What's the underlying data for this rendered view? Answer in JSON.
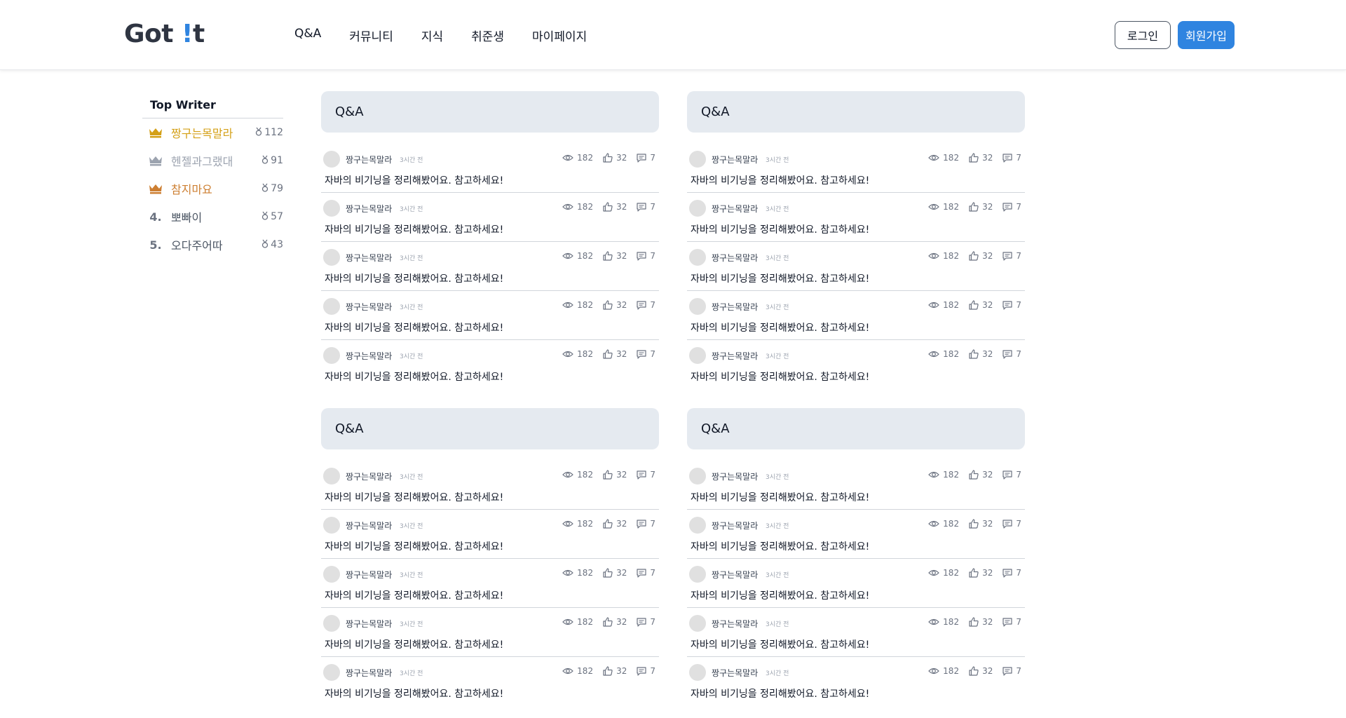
{
  "header": {
    "logo_main": "Got ",
    "logo_accent": "!",
    "logo_tail": "t",
    "nav": [
      "Q&A",
      "커뮤니티",
      "지식",
      "취준생",
      "마이페이지"
    ],
    "login_label": "로그인",
    "signup_label": "회원가입"
  },
  "sidebar": {
    "title": "Top Writer",
    "writers": [
      {
        "rank": "1",
        "icon": "crown-gold-icon",
        "name": "짱구는목말라",
        "score": "112",
        "color": "#d4a017"
      },
      {
        "rank": "2",
        "icon": "crown-silver-icon",
        "name": "헨젤과그랬대",
        "score": "91",
        "color": "#9ca3af"
      },
      {
        "rank": "3",
        "icon": "crown-bronze-icon",
        "name": "참지마요",
        "score": "79",
        "color": "#cd7f32"
      },
      {
        "rank": "4.",
        "icon": "",
        "name": "뽀빠이",
        "score": "57",
        "color": "#4b5563"
      },
      {
        "rank": "5.",
        "icon": "",
        "name": "오다주어따",
        "score": "43",
        "color": "#4b5563"
      }
    ]
  },
  "cards": [
    {
      "title": "Q&A",
      "posts": [
        {
          "author": "짱구는목말라",
          "time": "3시간 전",
          "views": "182",
          "likes": "32",
          "comments": "7",
          "title": "자바의 비기닝을 정리해봤어요. 참고하세요!"
        },
        {
          "author": "짱구는목말라",
          "time": "3시간 전",
          "views": "182",
          "likes": "32",
          "comments": "7",
          "title": "자바의 비기닝을 정리해봤어요. 참고하세요!"
        },
        {
          "author": "짱구는목말라",
          "time": "3시간 전",
          "views": "182",
          "likes": "32",
          "comments": "7",
          "title": "자바의 비기닝을 정리해봤어요. 참고하세요!"
        },
        {
          "author": "짱구는목말라",
          "time": "3시간 전",
          "views": "182",
          "likes": "32",
          "comments": "7",
          "title": "자바의 비기닝을 정리해봤어요. 참고하세요!"
        },
        {
          "author": "짱구는목말라",
          "time": "3시간 전",
          "views": "182",
          "likes": "32",
          "comments": "7",
          "title": "자바의 비기닝을 정리해봤어요. 참고하세요!"
        }
      ]
    },
    {
      "title": "Q&A",
      "posts": [
        {
          "author": "짱구는목말라",
          "time": "3시간 전",
          "views": "182",
          "likes": "32",
          "comments": "7",
          "title": "자바의 비기닝을 정리해봤어요. 참고하세요!"
        },
        {
          "author": "짱구는목말라",
          "time": "3시간 전",
          "views": "182",
          "likes": "32",
          "comments": "7",
          "title": "자바의 비기닝을 정리해봤어요. 참고하세요!"
        },
        {
          "author": "짱구는목말라",
          "time": "3시간 전",
          "views": "182",
          "likes": "32",
          "comments": "7",
          "title": "자바의 비기닝을 정리해봤어요. 참고하세요!"
        },
        {
          "author": "짱구는목말라",
          "time": "3시간 전",
          "views": "182",
          "likes": "32",
          "comments": "7",
          "title": "자바의 비기닝을 정리해봤어요. 참고하세요!"
        },
        {
          "author": "짱구는목말라",
          "time": "3시간 전",
          "views": "182",
          "likes": "32",
          "comments": "7",
          "title": "자바의 비기닝을 정리해봤어요. 참고하세요!"
        }
      ]
    },
    {
      "title": "Q&A",
      "posts": [
        {
          "author": "짱구는목말라",
          "time": "3시간 전",
          "views": "182",
          "likes": "32",
          "comments": "7",
          "title": "자바의 비기닝을 정리해봤어요. 참고하세요!"
        },
        {
          "author": "짱구는목말라",
          "time": "3시간 전",
          "views": "182",
          "likes": "32",
          "comments": "7",
          "title": "자바의 비기닝을 정리해봤어요. 참고하세요!"
        },
        {
          "author": "짱구는목말라",
          "time": "3시간 전",
          "views": "182",
          "likes": "32",
          "comments": "7",
          "title": "자바의 비기닝을 정리해봤어요. 참고하세요!"
        },
        {
          "author": "짱구는목말라",
          "time": "3시간 전",
          "views": "182",
          "likes": "32",
          "comments": "7",
          "title": "자바의 비기닝을 정리해봤어요. 참고하세요!"
        },
        {
          "author": "짱구는목말라",
          "time": "3시간 전",
          "views": "182",
          "likes": "32",
          "comments": "7",
          "title": "자바의 비기닝을 정리해봤어요. 참고하세요!"
        }
      ]
    },
    {
      "title": "Q&A",
      "posts": [
        {
          "author": "짱구는목말라",
          "time": "3시간 전",
          "views": "182",
          "likes": "32",
          "comments": "7",
          "title": "자바의 비기닝을 정리해봤어요. 참고하세요!"
        },
        {
          "author": "짱구는목말라",
          "time": "3시간 전",
          "views": "182",
          "likes": "32",
          "comments": "7",
          "title": "자바의 비기닝을 정리해봤어요. 참고하세요!"
        },
        {
          "author": "짱구는목말라",
          "time": "3시간 전",
          "views": "182",
          "likes": "32",
          "comments": "7",
          "title": "자바의 비기닝을 정리해봤어요. 참고하세요!"
        },
        {
          "author": "짱구는목말라",
          "time": "3시간 전",
          "views": "182",
          "likes": "32",
          "comments": "7",
          "title": "자바의 비기닝을 정리해봤어요. 참고하세요!"
        },
        {
          "author": "짱구는목말라",
          "time": "3시간 전",
          "views": "182",
          "likes": "32",
          "comments": "7",
          "title": "자바의 비기닝을 정리해봤어요. 참고하세요!"
        }
      ]
    }
  ]
}
